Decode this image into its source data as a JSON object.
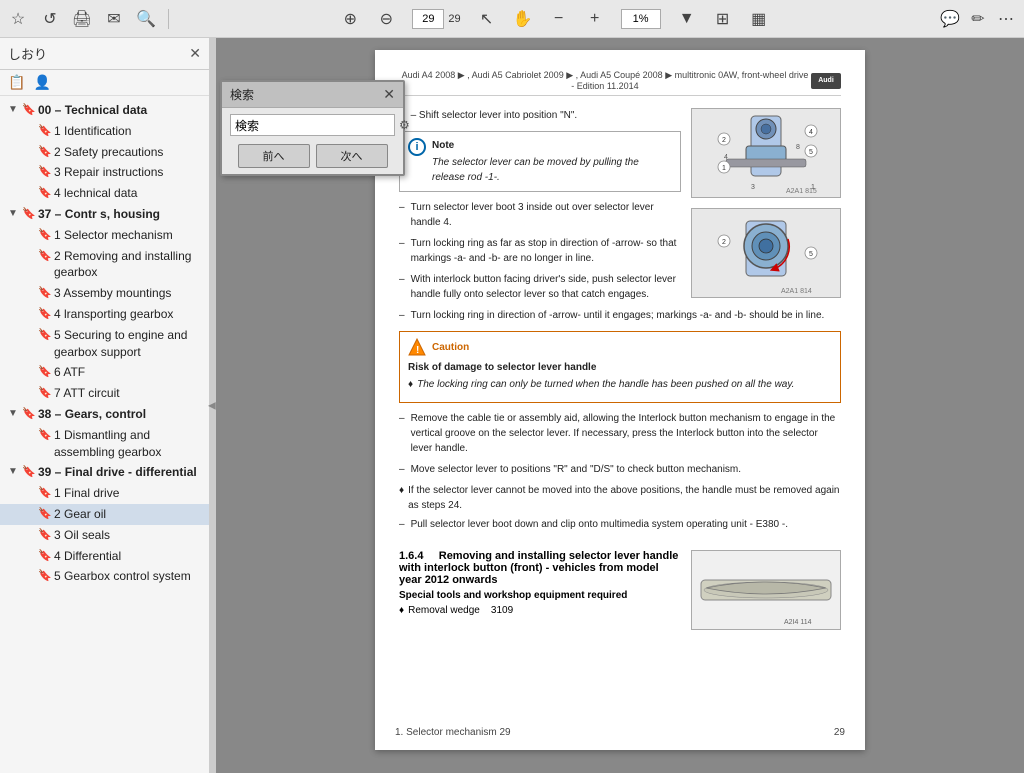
{
  "toolbar": {
    "bookmark_icon": "☆",
    "back_icon": "↺",
    "print_icon": "🖨",
    "mail_icon": "✉",
    "search_toolbar_icon": "🔍",
    "up_icon": "⊕",
    "down_icon": "⊖",
    "page_current": "29",
    "page_info": "29 / 1/1",
    "cursor_icon": "↖",
    "hand_icon": "✋",
    "zoom_out_icon": "−",
    "zoom_in_icon": "+",
    "zoom_level": "1%",
    "fit_icon": "⊞",
    "view_icon": "▦",
    "comment_icon": "💬",
    "pen_icon": "✏",
    "more_icon": "⋯"
  },
  "sidebar": {
    "header_text": "しおり",
    "close_icon": "✕",
    "icons": [
      "📋",
      "👤"
    ],
    "tree": [
      {
        "id": "00",
        "label": "00 – Technical data",
        "level": 0,
        "expanded": true,
        "hasChildren": true
      },
      {
        "id": "1id",
        "label": "1 Identification",
        "level": 1,
        "expanded": false,
        "hasChildren": false
      },
      {
        "id": "2sp",
        "label": "2 Safety precautions",
        "level": 1,
        "expanded": false,
        "hasChildren": false
      },
      {
        "id": "3ri",
        "label": "3 Repair instructions",
        "level": 1,
        "expanded": false,
        "hasChildren": false
      },
      {
        "id": "4td",
        "label": "4 Technical data",
        "level": 1,
        "expanded": false,
        "hasChildren": false
      },
      {
        "id": "37",
        "label": "37 – Controls, housing",
        "level": 0,
        "expanded": true,
        "hasChildren": true
      },
      {
        "id": "37-1",
        "label": "1 Selector mechanism",
        "level": 1,
        "expanded": false,
        "hasChildren": false
      },
      {
        "id": "37-2",
        "label": "2 Removing and installing gearbox",
        "level": 1,
        "expanded": false,
        "hasChildren": false
      },
      {
        "id": "37-3",
        "label": "3 Assembly mountings",
        "level": 1,
        "expanded": false,
        "hasChildren": false
      },
      {
        "id": "37-4",
        "label": "4 Transporting gearbox",
        "level": 1,
        "expanded": false,
        "hasChildren": false
      },
      {
        "id": "37-5",
        "label": "5 Securing to engine and gearbox support",
        "level": 1,
        "expanded": false,
        "hasChildren": false
      },
      {
        "id": "37-6",
        "label": "6 ATF",
        "level": 1,
        "expanded": false,
        "hasChildren": false
      },
      {
        "id": "37-7",
        "label": "7 ATF circuit",
        "level": 1,
        "expanded": false,
        "hasChildren": false
      },
      {
        "id": "38",
        "label": "38 – Gears, control",
        "level": 0,
        "expanded": true,
        "hasChildren": true
      },
      {
        "id": "38-1",
        "label": "1 Dismantling and assembling gearbox",
        "level": 1,
        "expanded": false,
        "hasChildren": false
      },
      {
        "id": "39",
        "label": "39 – Final drive - differential",
        "level": 0,
        "expanded": true,
        "hasChildren": true
      },
      {
        "id": "39-1",
        "label": "1 Final drive",
        "level": 1,
        "expanded": false,
        "hasChildren": false
      },
      {
        "id": "39-2",
        "label": "2 Gear oil",
        "level": 1,
        "expanded": false,
        "hasChildren": false,
        "active": true
      },
      {
        "id": "39-3",
        "label": "3 Oil seals",
        "level": 1,
        "expanded": false,
        "hasChildren": false
      },
      {
        "id": "39-4",
        "label": "4 Differential",
        "level": 1,
        "expanded": false,
        "hasChildren": false
      },
      {
        "id": "39-5",
        "label": "5 Gearbox control system",
        "level": 1,
        "expanded": false,
        "hasChildren": false
      }
    ]
  },
  "search_dialog": {
    "title": "検索",
    "close_icon": "✕",
    "input_placeholder": "検索",
    "gear_icon": "⚙",
    "prev_button": "前へ",
    "next_button": "次へ"
  },
  "doc": {
    "header_text": "Audi A4 2008 ▶ , Audi A5 Cabriolet 2009 ▶ , Audi A5 Coupé 2008 ▶ multitronic 0AW, front-wheel drive - Edition 11.2014",
    "header_brand": "Audi",
    "step1": "– Shift selector lever into position \"N\".",
    "note_title": "Note",
    "note_text": "The selector lever can be moved by pulling the release rod -1-.",
    "step2": "Turn selector lever boot 3 inside out over selector lever handle 4.",
    "step3": "Turn locking ring as far as stop in direction of -arrow- so that markings -a- and -b- are no longer in line.",
    "step4": "With interlock button facing driver's side, push selector lever handle fully onto selector lever so that catch engages.",
    "step5": "Turn locking ring in direction of -arrow- until it engages; markings -a- and -b- should be in line.",
    "caution_title": "Caution",
    "caution_subtitle": "Risk of damage to selector lever handle",
    "caution_text": "The locking ring can only be turned when the handle has been pushed on all the way.",
    "step6": "Remove the cable tie or assembly aid, allowing the Interlock button mechanism to engage in the vertical groove on the selector lever. If necessary, press the Interlock button into the selector lever handle.",
    "step7": "Move selector lever to positions \"R\" and \"D/S\" to check button mechanism.",
    "bullet1": "If the selector lever cannot be moved into the above positions, the handle must be removed again as steps 24.",
    "step8": "Pull selector lever boot down and clip onto multimedia system operating unit - E380 -.",
    "section_num": "1.6.4",
    "section_title": "Removing and installing selector lever handle with interlock button (front) - vehicles from model year 2012 onwards",
    "special_tools_label": "Special tools and workshop equipment required",
    "tool_bullet": "♦ Removal wedge   3109",
    "page_number": "29",
    "page_section": "1. Selector mechanism  29",
    "image1_label": "A2A1 815",
    "image2_label": "A2A1 814",
    "image3_label": "A2I4 114"
  }
}
